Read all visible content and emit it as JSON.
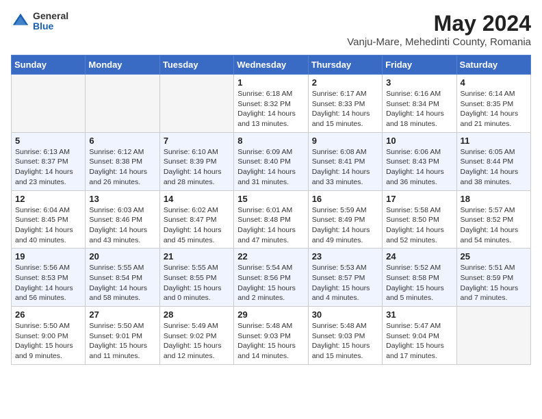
{
  "header": {
    "logo_line1": "General",
    "logo_line2": "Blue",
    "month_year": "May 2024",
    "location": "Vanju-Mare, Mehedinti County, Romania"
  },
  "weekdays": [
    "Sunday",
    "Monday",
    "Tuesday",
    "Wednesday",
    "Thursday",
    "Friday",
    "Saturday"
  ],
  "weeks": [
    [
      {
        "day": "",
        "info": ""
      },
      {
        "day": "",
        "info": ""
      },
      {
        "day": "",
        "info": ""
      },
      {
        "day": "1",
        "info": "Sunrise: 6:18 AM\nSunset: 8:32 PM\nDaylight: 14 hours\nand 13 minutes."
      },
      {
        "day": "2",
        "info": "Sunrise: 6:17 AM\nSunset: 8:33 PM\nDaylight: 14 hours\nand 15 minutes."
      },
      {
        "day": "3",
        "info": "Sunrise: 6:16 AM\nSunset: 8:34 PM\nDaylight: 14 hours\nand 18 minutes."
      },
      {
        "day": "4",
        "info": "Sunrise: 6:14 AM\nSunset: 8:35 PM\nDaylight: 14 hours\nand 21 minutes."
      }
    ],
    [
      {
        "day": "5",
        "info": "Sunrise: 6:13 AM\nSunset: 8:37 PM\nDaylight: 14 hours\nand 23 minutes."
      },
      {
        "day": "6",
        "info": "Sunrise: 6:12 AM\nSunset: 8:38 PM\nDaylight: 14 hours\nand 26 minutes."
      },
      {
        "day": "7",
        "info": "Sunrise: 6:10 AM\nSunset: 8:39 PM\nDaylight: 14 hours\nand 28 minutes."
      },
      {
        "day": "8",
        "info": "Sunrise: 6:09 AM\nSunset: 8:40 PM\nDaylight: 14 hours\nand 31 minutes."
      },
      {
        "day": "9",
        "info": "Sunrise: 6:08 AM\nSunset: 8:41 PM\nDaylight: 14 hours\nand 33 minutes."
      },
      {
        "day": "10",
        "info": "Sunrise: 6:06 AM\nSunset: 8:43 PM\nDaylight: 14 hours\nand 36 minutes."
      },
      {
        "day": "11",
        "info": "Sunrise: 6:05 AM\nSunset: 8:44 PM\nDaylight: 14 hours\nand 38 minutes."
      }
    ],
    [
      {
        "day": "12",
        "info": "Sunrise: 6:04 AM\nSunset: 8:45 PM\nDaylight: 14 hours\nand 40 minutes."
      },
      {
        "day": "13",
        "info": "Sunrise: 6:03 AM\nSunset: 8:46 PM\nDaylight: 14 hours\nand 43 minutes."
      },
      {
        "day": "14",
        "info": "Sunrise: 6:02 AM\nSunset: 8:47 PM\nDaylight: 14 hours\nand 45 minutes."
      },
      {
        "day": "15",
        "info": "Sunrise: 6:01 AM\nSunset: 8:48 PM\nDaylight: 14 hours\nand 47 minutes."
      },
      {
        "day": "16",
        "info": "Sunrise: 5:59 AM\nSunset: 8:49 PM\nDaylight: 14 hours\nand 49 minutes."
      },
      {
        "day": "17",
        "info": "Sunrise: 5:58 AM\nSunset: 8:50 PM\nDaylight: 14 hours\nand 52 minutes."
      },
      {
        "day": "18",
        "info": "Sunrise: 5:57 AM\nSunset: 8:52 PM\nDaylight: 14 hours\nand 54 minutes."
      }
    ],
    [
      {
        "day": "19",
        "info": "Sunrise: 5:56 AM\nSunset: 8:53 PM\nDaylight: 14 hours\nand 56 minutes."
      },
      {
        "day": "20",
        "info": "Sunrise: 5:55 AM\nSunset: 8:54 PM\nDaylight: 14 hours\nand 58 minutes."
      },
      {
        "day": "21",
        "info": "Sunrise: 5:55 AM\nSunset: 8:55 PM\nDaylight: 15 hours\nand 0 minutes."
      },
      {
        "day": "22",
        "info": "Sunrise: 5:54 AM\nSunset: 8:56 PM\nDaylight: 15 hours\nand 2 minutes."
      },
      {
        "day": "23",
        "info": "Sunrise: 5:53 AM\nSunset: 8:57 PM\nDaylight: 15 hours\nand 4 minutes."
      },
      {
        "day": "24",
        "info": "Sunrise: 5:52 AM\nSunset: 8:58 PM\nDaylight: 15 hours\nand 5 minutes."
      },
      {
        "day": "25",
        "info": "Sunrise: 5:51 AM\nSunset: 8:59 PM\nDaylight: 15 hours\nand 7 minutes."
      }
    ],
    [
      {
        "day": "26",
        "info": "Sunrise: 5:50 AM\nSunset: 9:00 PM\nDaylight: 15 hours\nand 9 minutes."
      },
      {
        "day": "27",
        "info": "Sunrise: 5:50 AM\nSunset: 9:01 PM\nDaylight: 15 hours\nand 11 minutes."
      },
      {
        "day": "28",
        "info": "Sunrise: 5:49 AM\nSunset: 9:02 PM\nDaylight: 15 hours\nand 12 minutes."
      },
      {
        "day": "29",
        "info": "Sunrise: 5:48 AM\nSunset: 9:03 PM\nDaylight: 15 hours\nand 14 minutes."
      },
      {
        "day": "30",
        "info": "Sunrise: 5:48 AM\nSunset: 9:03 PM\nDaylight: 15 hours\nand 15 minutes."
      },
      {
        "day": "31",
        "info": "Sunrise: 5:47 AM\nSunset: 9:04 PM\nDaylight: 15 hours\nand 17 minutes."
      },
      {
        "day": "",
        "info": ""
      }
    ]
  ]
}
